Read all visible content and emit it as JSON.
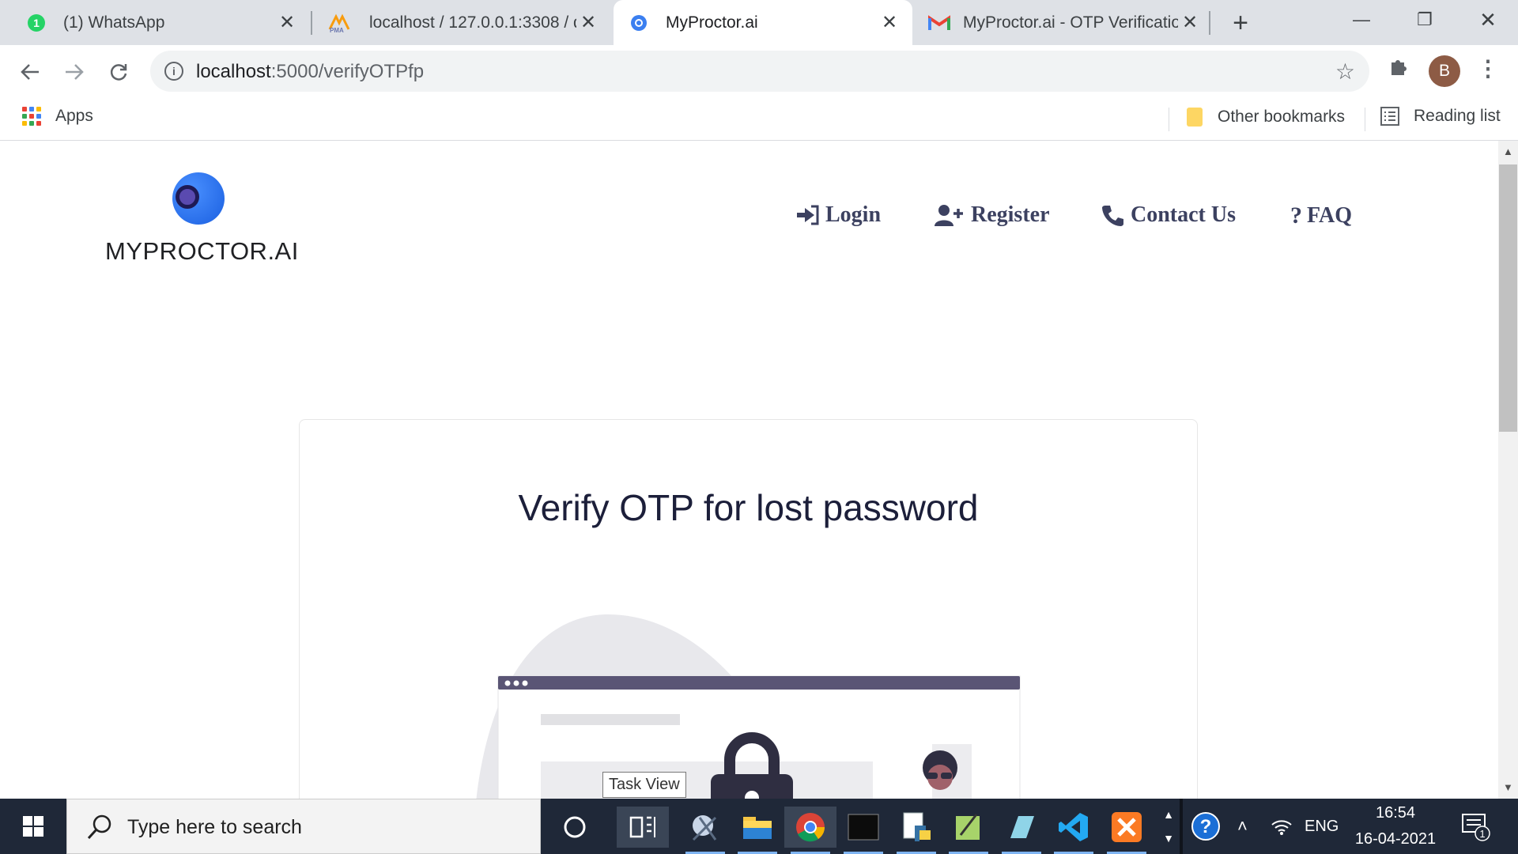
{
  "browser": {
    "tabs": [
      {
        "title": "(1) WhatsApp",
        "icon": "whatsapp-icon"
      },
      {
        "title": "localhost / 127.0.0.1:3308 / q",
        "icon": "phpmyadmin-icon"
      },
      {
        "title": "MyProctor.ai",
        "icon": "myproctor-favicon",
        "active": true
      },
      {
        "title": "MyProctor.ai - OTP Verificatio",
        "icon": "gmail-icon"
      }
    ],
    "whatsapp_badge": "1",
    "url_host": "localhost",
    "url_path": ":5000/verifyOTPfp",
    "profile_initial": "B",
    "bookmarks": {
      "apps": "Apps",
      "other": "Other bookmarks",
      "reading_list": "Reading list"
    }
  },
  "site": {
    "brand": "MYPROCTOR.AI",
    "nav": [
      {
        "label": "Login",
        "icon": "sign-in-icon"
      },
      {
        "label": "Register",
        "icon": "user-plus-icon"
      },
      {
        "label": "Contact Us",
        "icon": "phone-icon"
      },
      {
        "label": "FAQ",
        "icon": "question-icon"
      }
    ],
    "card_title": "Verify OTP for lost password"
  },
  "taskbar": {
    "search_placeholder": "Type here to search",
    "tooltip": "Task View",
    "language": "ENG",
    "time": "16:54",
    "date": "16-04-2021",
    "notification_count": "1"
  },
  "colors": {
    "nav_text": "#3c4160",
    "illustration_dark": "#2f2e41",
    "browser_bar": "#5a5575",
    "taskbar_bg": "#1f2838"
  }
}
